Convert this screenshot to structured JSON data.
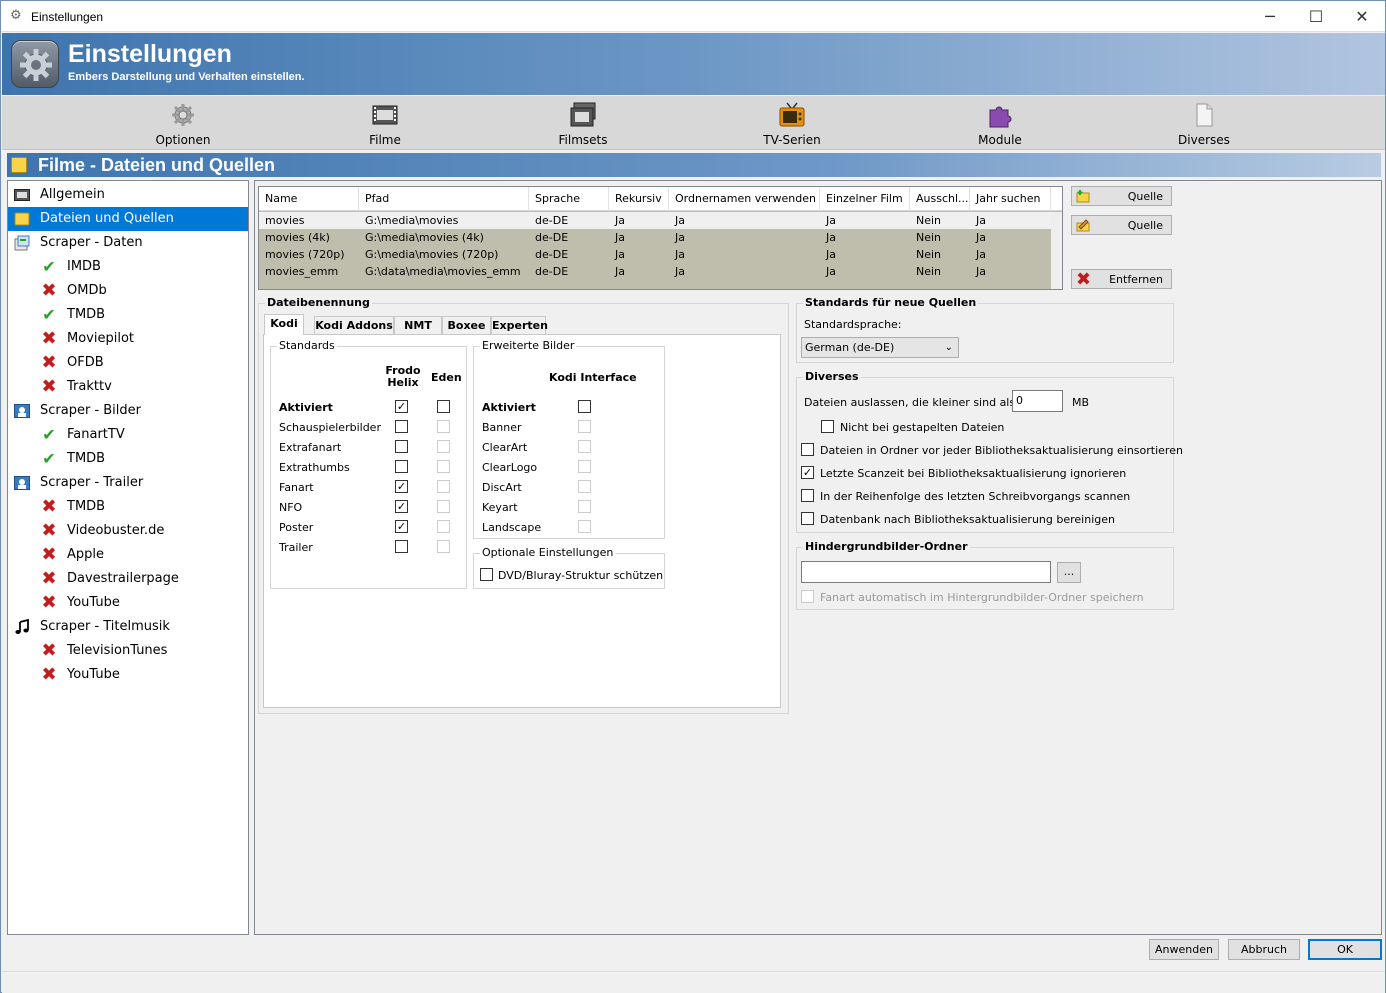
{
  "window": {
    "title": "Einstellungen",
    "minimize": "─",
    "maximize": "☐",
    "close": "✕"
  },
  "header": {
    "title": "Einstellungen",
    "subtitle": "Embers Darstellung und Verhalten einstellen."
  },
  "toolbar": {
    "items": [
      {
        "label": "Optionen",
        "icon": "gear-icon"
      },
      {
        "label": "Filme",
        "icon": "film-icon"
      },
      {
        "label": "Filmsets",
        "icon": "filmsets-icon"
      },
      {
        "label": "TV-Serien",
        "icon": "tv-icon"
      },
      {
        "label": "Module",
        "icon": "puzzle-icon"
      },
      {
        "label": "Diverses",
        "icon": "document-icon"
      }
    ]
  },
  "section": {
    "title": "Filme - Dateien und Quellen"
  },
  "tree": {
    "items": [
      {
        "label": "Allgemein",
        "icon": "film-icon",
        "level": 0
      },
      {
        "label": "Dateien und Quellen",
        "icon": "folder-icon",
        "level": 0,
        "selected": true
      },
      {
        "label": "Scraper - Daten",
        "icon": "data-icon",
        "level": 0
      },
      {
        "label": "IMDB",
        "status": "enabled",
        "level": 1
      },
      {
        "label": "OMDb",
        "status": "disabled",
        "level": 1
      },
      {
        "label": "TMDB",
        "status": "enabled",
        "level": 1
      },
      {
        "label": "Moviepilot",
        "status": "disabled",
        "level": 1
      },
      {
        "label": "OFDB",
        "status": "disabled",
        "level": 1
      },
      {
        "label": "Trakttv",
        "status": "disabled",
        "level": 1
      },
      {
        "label": "Scraper - Bilder",
        "icon": "image-icon",
        "level": 0
      },
      {
        "label": "FanartTV",
        "status": "enabled",
        "level": 1
      },
      {
        "label": "TMDB",
        "status": "enabled",
        "level": 1
      },
      {
        "label": "Scraper - Trailer",
        "icon": "image-icon",
        "level": 0
      },
      {
        "label": "TMDB",
        "status": "disabled",
        "level": 1
      },
      {
        "label": "Videobuster.de",
        "status": "disabled",
        "level": 1
      },
      {
        "label": "Apple",
        "status": "disabled",
        "level": 1
      },
      {
        "label": "Davestrailerpage",
        "status": "disabled",
        "level": 1
      },
      {
        "label": "YouTube",
        "status": "disabled",
        "level": 1
      },
      {
        "label": "Scraper - Titelmusik",
        "icon": "music-icon",
        "level": 0
      },
      {
        "label": "TelevisionTunes",
        "status": "disabled",
        "level": 1
      },
      {
        "label": "YouTube",
        "status": "disabled",
        "level": 1
      }
    ]
  },
  "sources": {
    "columns": [
      "Name",
      "Pfad",
      "Sprache",
      "Rekursiv",
      "Ordnernamen verwenden",
      "Einzelner Film",
      "Ausschl...",
      "Jahr suchen"
    ],
    "rows": [
      [
        "movies",
        "G:\\media\\movies",
        "de-DE",
        "Ja",
        "Ja",
        "Ja",
        "Nein",
        "Ja"
      ],
      [
        "movies (4k)",
        "G:\\media\\movies (4k)",
        "de-DE",
        "Ja",
        "Ja",
        "Ja",
        "Nein",
        "Ja"
      ],
      [
        "movies (720p)",
        "G:\\media\\movies (720p)",
        "de-DE",
        "Ja",
        "Ja",
        "Ja",
        "Nein",
        "Ja"
      ],
      [
        "movies_emm",
        "G:\\data\\media\\movies_emm",
        "de-DE",
        "Ja",
        "Ja",
        "Ja",
        "Nein",
        "Ja"
      ]
    ],
    "buttons": {
      "add": "Quelle",
      "edit": "Quelle",
      "remove": "Entfernen"
    }
  },
  "naming": {
    "title": "Dateibenennung",
    "tabs": [
      "Kodi",
      "Kodi Addons",
      "NMT",
      "Boxee",
      "Experten"
    ],
    "standards": {
      "title": "Standards",
      "col1": "Frodo\nHelix",
      "col2": "Eden",
      "rows": [
        {
          "label": "Aktiviert",
          "bold": true,
          "frodo": true,
          "eden": false,
          "eden_enabled": true
        },
        {
          "label": "Schauspielerbilder",
          "frodo": false,
          "eden": false,
          "eden_enabled": false
        },
        {
          "label": "Extrafanart",
          "frodo": false,
          "eden": false,
          "eden_enabled": false
        },
        {
          "label": "Extrathumbs",
          "frodo": false,
          "eden": false,
          "eden_enabled": false
        },
        {
          "label": "Fanart",
          "frodo": true,
          "eden": false,
          "eden_enabled": false
        },
        {
          "label": "NFO",
          "frodo": true,
          "eden": false,
          "eden_enabled": false
        },
        {
          "label": "Poster",
          "frodo": true,
          "eden": false,
          "eden_enabled": false
        },
        {
          "label": "Trailer",
          "frodo": false,
          "eden": false,
          "eden_enabled": false
        }
      ]
    },
    "extended": {
      "title": "Erweiterte Bilder",
      "col": "Kodi Interface",
      "rows": [
        {
          "label": "Aktiviert",
          "bold": true,
          "checked": false,
          "enabled": true
        },
        {
          "label": "Banner",
          "checked": false,
          "enabled": false
        },
        {
          "label": "ClearArt",
          "checked": false,
          "enabled": false
        },
        {
          "label": "ClearLogo",
          "checked": false,
          "enabled": false
        },
        {
          "label": "DiscArt",
          "checked": false,
          "enabled": false
        },
        {
          "label": "Keyart",
          "checked": false,
          "enabled": false
        },
        {
          "label": "Landscape",
          "checked": false,
          "enabled": false
        }
      ]
    },
    "optional": {
      "title": "Optionale Einstellungen",
      "dvd": "DVD/Bluray-Struktur schützen"
    }
  },
  "defaults": {
    "title": "Standards für neue Quellen",
    "lang_label": "Standardsprache:",
    "lang_value": "German (de-DE)"
  },
  "misc": {
    "title": "Diverses",
    "skip_label": "Dateien auslassen, die kleiner sind als:",
    "skip_value": "0",
    "skip_unit": "MB",
    "not_stacked": "Nicht bei gestapelten Dateien",
    "sort_before": "Dateien in Ordner vor jeder Bibliotheksaktualisierung einsortieren",
    "ignore_scan": "Letzte Scanzeit bei Bibliotheksaktualisierung ignorieren",
    "scan_order": "In der Reihenfolge des letzten Schreibvorgangs scannen",
    "cleanup": "Datenbank nach Bibliotheksaktualisierung bereinigen"
  },
  "background": {
    "title": "Hindergrundbilder-Ordner",
    "browse": "...",
    "auto_fanart": "Fanart automatisch im Hintergrundbilder-Ordner speichern"
  },
  "footer": {
    "apply": "Anwenden",
    "cancel": "Abbruch",
    "ok": "OK"
  }
}
